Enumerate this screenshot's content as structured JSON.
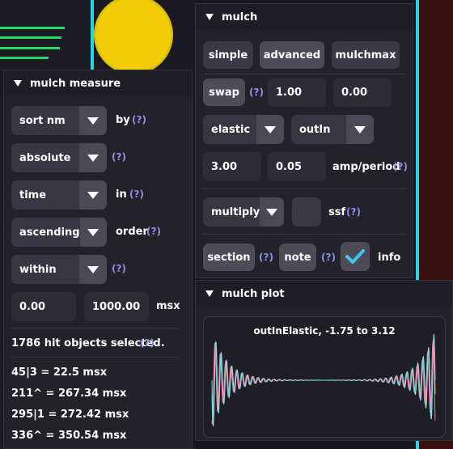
{
  "measure_panel": {
    "title": "mulch measure",
    "rows": [
      {
        "select": "sort nm",
        "label": "by",
        "help": "(?)"
      },
      {
        "select": "absolute",
        "label": "",
        "help": "(?)"
      },
      {
        "select": "time",
        "label": "in",
        "help": "(?)"
      },
      {
        "select": "ascending",
        "label": "order",
        "help": "(?)"
      },
      {
        "select": "within",
        "label": "",
        "help": "(?)"
      }
    ],
    "range_min": "0.00",
    "range_max": "1000.00",
    "range_unit": "msx",
    "selected_status": "1786 hit objects selected.",
    "selected_help": "(?)",
    "results": [
      "45|3 = 22.5 msx",
      "211^ = 267.34 msx",
      "295|1 = 272.42 msx",
      "336^ = 350.54 msx"
    ]
  },
  "mulch_panel": {
    "title": "mulch",
    "tabs": [
      "simple",
      "advanced",
      "mulchmax"
    ],
    "swap_label": "swap",
    "swap_help": "(?)",
    "value_a": "1.00",
    "value_b": "0.00",
    "easing_type": "elastic",
    "easing_mode": "outIn",
    "amp": "3.00",
    "period": "0.05",
    "amp_period_label": "amp/period",
    "amp_period_help": "(?)",
    "operation": "multiply",
    "ssf_label": "ssf",
    "ssf_help": "(?)",
    "section_label": "section",
    "section_help": "(?)",
    "note_label": "note",
    "note_help": "(?)",
    "info_label": "info",
    "info_checked": true
  },
  "plot_panel": {
    "title": "mulch plot",
    "plot_title": "outInElastic, -1.75 to 3.12"
  },
  "colors": {
    "accent_cyan": "#27d3e6",
    "check": "#3fc7f0",
    "help": "#8a8ff0",
    "yellow_ball": "#f2cc07"
  }
}
